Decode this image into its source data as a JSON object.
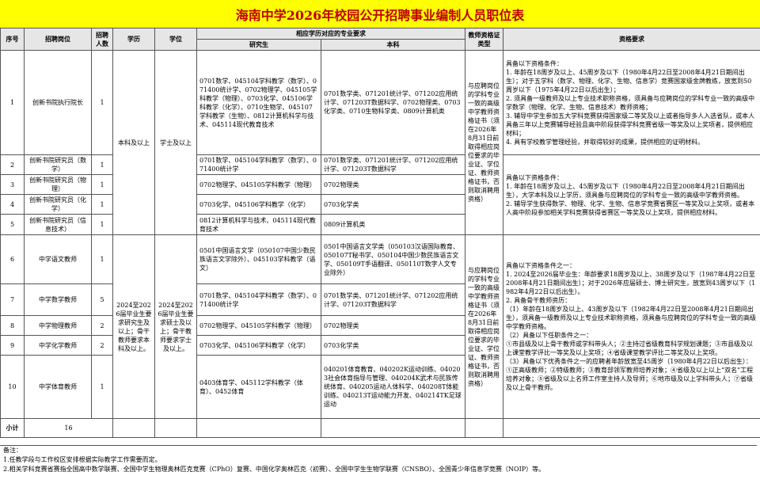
{
  "title": "海南中学2026年校园公开招聘事业编制人员职位表",
  "headers": {
    "seq": "序号",
    "post": "招聘岗位",
    "count": "招聘人数",
    "edu": "学历",
    "degree": "学位",
    "major": "相应学历对应的专业要求",
    "grad": "研究生",
    "undergrad": "本科",
    "cert": "教师资格证类型",
    "qual": "资格要求"
  },
  "edu_group1": "本科及以上",
  "degree_group1": "学士及以上",
  "edu_group2": "2024至2026届毕业生要求研究生及以上；骨干教师要求本科及以上。",
  "degree_group2": "2024至2026届毕业生要求硕士及以上；骨干教师要求学士及以上。",
  "cert_group1": "与应聘岗位的学科专业一致的高级中学教师资格证书（须在2026年8月31日前取得相应岗位要求的毕业证、学位证、教师资格证书，否则取消聘用资格）",
  "cert_group2": "与应聘岗位的学科专业一致的高级中学教师资格证书（须在2026年8月31日前取得相应岗位要求的毕业证、学位证、教师资格证书，否则取消聘用资格）",
  "qual_a": "具备以下资格条件：\n1. 年龄在18周岁及以上、45周岁及以下（1980年4月22日至2008年4月21日期间出生）；对于五学科（数学、物理、化学、生物、信息学）竞赛国家级金牌教练，放宽到50周岁以下（1975年4月22日以后出生）；\n2. 须具备一级教师及以上专业技术职称资格，须具备与应聘岗位的学科专业一致的高级中学数学（物理、化学、生物、信息技术）教师资格；\n3. 辅导中学生参加五大学科竞赛获得国家级二等奖及以上或者指导多人入选省队，或本人具备三年以上竞赛辅导经验且高中阶段获得学科竞赛省级一等奖及以上奖项者，提供相应材料；\n4. 具有学校教学管理经验，并取得较好的成果，提供相应的证明材料。",
  "qual_b": "具备以下资格条件：\n1. 年龄在18周岁及以上、45周岁及以下（1980年4月22日至2008年4月21日期间出生），大学本科及以上学历，须具备与应聘岗位的学科专业一致的高级中学教师资格。\n2. 辅导学生获得数学、物理、化学、生物、信息学竞赛省赛区一等奖及以上奖项，或者本人高中阶段参加相关学科竞赛获得省赛区一等奖及以上奖项，提供相应材料。",
  "qual_c": "具备以下资格条件之一：\n1. 2024至2026届毕业生：年龄要求18周岁及以上、38周岁及以下（1987年4月22日至2008年4月21日期间出生）；对于2026年应届硕士、博士研究生，放宽到43周岁以下（1982年4月22日以后出生）。\n2. 具备骨干教师资历：\n（1）年龄在18周岁及以上、43周岁及以下（1982年4月22日至2008年4月21日期间出生），须具备一级教师及以上专业技术职称资格，须具备与应聘岗位的学科专业一致的高级中学教师资格。\n（2）具备以下任职条件之一：\n①市县级及以上骨干教师或学科带头人；②主持过省级教育科学规划课题；③市县级及以上课堂教学评比一等奖及以上奖项；④省级课堂教学评比二等奖及以上奖项。\n（3）具备以下优秀条件之一的应聘者年龄放宽至45周岁（1980年4月22日以后出生）：①正高级教师；②特级教师；③教育部领军教师培养对象；④省级及以上以上“双名”工程培养对象；⑤省级及以上名师工作室主持人及导师；⑥地市级及以上学科带头人；⑦省级及以上骨干教师。",
  "rows": [
    {
      "seq": "1",
      "post": "创新书院执行院长",
      "count": "1",
      "grad": "0701数学、045104学科教学（数学）、071400统计学、0702物理学、045105学科教学（物理）、0703化学、045106学科教学（化学）、0710生物学、045107学科教学（生物）、0812计算机科学与技术、045114现代教育技术",
      "ug": "0701数学类、071201统计学、071202应用统计学、071203T数据科学、0702物理类、0703化学类、0710生物科学类、0809计算机类"
    },
    {
      "seq": "2",
      "post": "创新书院研究员（数学）",
      "count": "1",
      "grad": "0701数学、045104学科教学（数学）、071400统计学",
      "ug": "0701数学类、071201统计学、071202应用统计学、071203T数据科学"
    },
    {
      "seq": "3",
      "post": "创新书院研究员（物理）",
      "count": "1",
      "grad": "0702物理学、045105学科教学（物理）",
      "ug": "0702物理类"
    },
    {
      "seq": "4",
      "post": "创新书院研究员（化学）",
      "count": "1",
      "grad": "0703化学、045106学科教学（化学）",
      "ug": "0703化学类"
    },
    {
      "seq": "5",
      "post": "创新书院研究员（信息技术）",
      "count": "1",
      "grad": "0812计算机科学与技术、045114现代教育技术",
      "ug": "0809计算机类"
    },
    {
      "seq": "6",
      "post": "中学语文教师",
      "count": "1",
      "grad": "0501中国语言文学（050107中国少数民族语言文学除外）、045103学科教学（语文）",
      "ug": "0501中国语言文学类（050103汉语国际教育、050107T秘书学、050104中国少数民族语言文学、050109T手语翻译、050110T数字人文专业除外）"
    },
    {
      "seq": "7",
      "post": "中学数学教师",
      "count": "5",
      "grad": "0701数学、045104学科教学（数学）、071400统计学",
      "ug": "0701数学类、071201统计学、071202应用统计学、071203T数据科学"
    },
    {
      "seq": "8",
      "post": "中学物理教师",
      "count": "2",
      "grad": "0702物理学、045105学科教学（物理）",
      "ug": "0702物理类"
    },
    {
      "seq": "9",
      "post": "中学化学教师",
      "count": "2",
      "grad": "0703化学、045106学科教学（化学）",
      "ug": "0703化学类"
    },
    {
      "seq": "10",
      "post": "中学体育教师",
      "count": "1",
      "grad": "0403体育学、045112学科教学（体育）、0452体育",
      "ug": "040201体育教育、040202K运动训练、040203社会体育指导与管理、040204K武术与民族传统体育、040205运动人体科学、040208T体能训练、040213T运动能力开发、040214TK足球运动"
    }
  ],
  "total": {
    "label": "小计",
    "value": "16"
  },
  "notes": [
    "备注：",
    "1.任教学段与工作校区安排根据实际教学工作需要而定。",
    "2.相关学科竞赛省赛指全国高中数学联赛、全国中学生物理奥林匹克竞赛（CPhO）复赛、中国化学奥林匹克（初赛）、全国中学生生物学联赛（CNSBO）、全国青少年信息学竞赛（NOIP）等。"
  ]
}
